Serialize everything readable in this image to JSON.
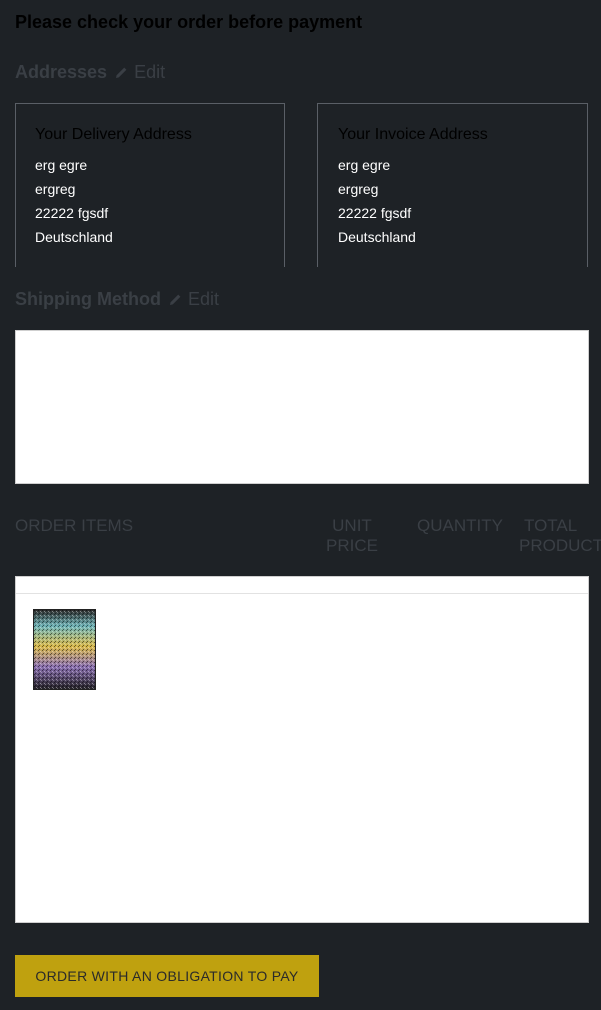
{
  "page_title": "Please check your order before payment",
  "addresses": {
    "heading": "Addresses",
    "edit_label": "Edit",
    "delivery": {
      "title": "Your Delivery Address",
      "lines": [
        "erg egre",
        "ergreg",
        "22222 fgsdf",
        "Deutschland"
      ]
    },
    "invoice": {
      "title": "Your Invoice Address",
      "lines": [
        "erg egre",
        "ergreg",
        "22222 fgsdf",
        "Deutschland"
      ]
    }
  },
  "shipping": {
    "heading": "Shipping Method",
    "edit_label": "Edit"
  },
  "order_items": {
    "columns": {
      "items": "ORDER ITEMS",
      "unit_price_1": "UNIT",
      "unit_price_2": "PRICE",
      "quantity": "QUANTITY",
      "total_1": "TOTAL",
      "total_2": "PRODUCT"
    }
  },
  "order_button_label": "ORDER WITH AN OBLIGATION TO PAY",
  "colors": {
    "background": "#1e2226",
    "muted_text": "#3a3f45",
    "button": "#bfa10f"
  }
}
